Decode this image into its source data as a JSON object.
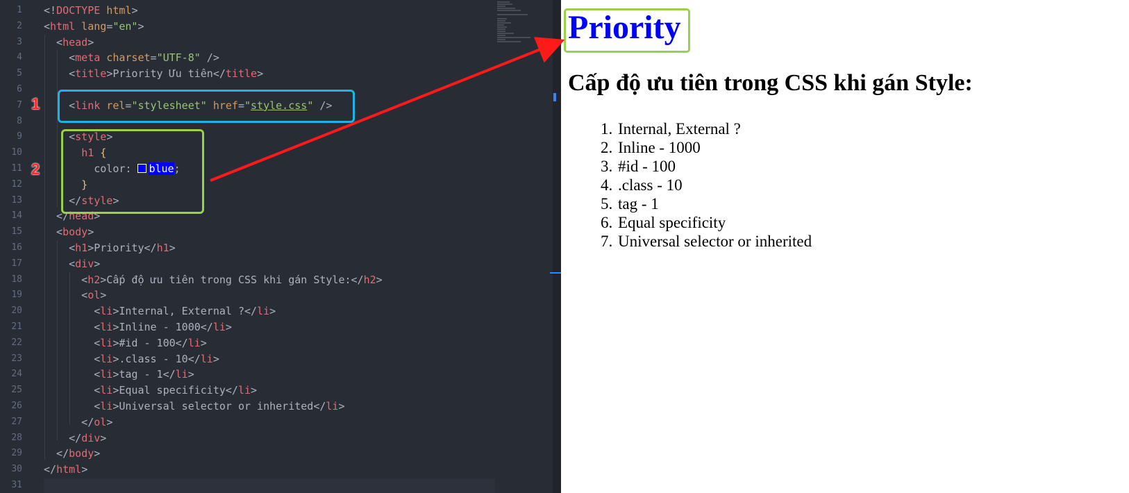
{
  "editor": {
    "line_numbers": [
      "1",
      "2",
      "3",
      "4",
      "5",
      "6",
      "7",
      "8",
      "9",
      "10",
      "11",
      "12",
      "13",
      "14",
      "15",
      "16",
      "17",
      "18",
      "19",
      "20",
      "21",
      "22",
      "23",
      "24",
      "25",
      "26",
      "27",
      "28",
      "29",
      "30",
      "31"
    ],
    "lines": [
      {
        "tokens": [
          {
            "c": "p",
            "t": "<!"
          },
          {
            "c": "t",
            "t": "DOCTYPE"
          },
          {
            "c": "a",
            "t": " html"
          },
          {
            "c": "p",
            "t": ">"
          }
        ]
      },
      {
        "tokens": [
          {
            "c": "p",
            "t": "<"
          },
          {
            "c": "t",
            "t": "html"
          },
          {
            "c": "a",
            "t": " lang"
          },
          {
            "c": "p",
            "t": "="
          },
          {
            "c": "s",
            "t": "\"en\""
          },
          {
            "c": "p",
            "t": ">"
          }
        ]
      },
      {
        "tokens": [
          {
            "c": "p",
            "t": "  <"
          },
          {
            "c": "t",
            "t": "head"
          },
          {
            "c": "p",
            "t": ">"
          }
        ]
      },
      {
        "tokens": [
          {
            "c": "p",
            "t": "    <"
          },
          {
            "c": "t",
            "t": "meta"
          },
          {
            "c": "a",
            "t": " charset"
          },
          {
            "c": "p",
            "t": "="
          },
          {
            "c": "s",
            "t": "\"UTF-8\""
          },
          {
            "c": "p",
            "t": " />"
          }
        ]
      },
      {
        "tokens": [
          {
            "c": "p",
            "t": "    <"
          },
          {
            "c": "t",
            "t": "title"
          },
          {
            "c": "p",
            "t": ">Priority Ưu tiên</"
          },
          {
            "c": "t",
            "t": "title"
          },
          {
            "c": "p",
            "t": ">"
          }
        ]
      },
      {
        "tokens": []
      },
      {
        "tokens": [
          {
            "c": "p",
            "t": "    <"
          },
          {
            "c": "t",
            "t": "link"
          },
          {
            "c": "a",
            "t": " rel"
          },
          {
            "c": "p",
            "t": "="
          },
          {
            "c": "s",
            "t": "\"stylesheet\""
          },
          {
            "c": "a",
            "t": " href"
          },
          {
            "c": "p",
            "t": "="
          },
          {
            "c": "s",
            "t": "\""
          },
          {
            "c": "u",
            "t": "style.css"
          },
          {
            "c": "s",
            "t": "\""
          },
          {
            "c": "p",
            "t": " />"
          }
        ]
      },
      {
        "tokens": []
      },
      {
        "tokens": [
          {
            "c": "p",
            "t": "    <"
          },
          {
            "c": "t",
            "t": "style"
          },
          {
            "c": "p",
            "t": ">"
          }
        ]
      },
      {
        "tokens": [
          {
            "c": "p",
            "t": "      "
          },
          {
            "c": "t",
            "t": "h1"
          },
          {
            "c": "y",
            "t": " {"
          }
        ]
      },
      {
        "tokens": [
          {
            "c": "p",
            "t": "        color: "
          },
          {
            "c": "sw",
            "t": ""
          },
          {
            "c": "bl",
            "t": "blue"
          },
          {
            "c": "p",
            "t": ";"
          }
        ]
      },
      {
        "tokens": [
          {
            "c": "y",
            "t": "      }"
          }
        ]
      },
      {
        "tokens": [
          {
            "c": "p",
            "t": "    </"
          },
          {
            "c": "t",
            "t": "style"
          },
          {
            "c": "p",
            "t": ">"
          }
        ]
      },
      {
        "tokens": [
          {
            "c": "p",
            "t": "  </"
          },
          {
            "c": "t",
            "t": "head"
          },
          {
            "c": "p",
            "t": ">"
          }
        ]
      },
      {
        "tokens": [
          {
            "c": "p",
            "t": "  <"
          },
          {
            "c": "t",
            "t": "body"
          },
          {
            "c": "p",
            "t": ">"
          }
        ]
      },
      {
        "tokens": [
          {
            "c": "p",
            "t": "    <"
          },
          {
            "c": "t",
            "t": "h1"
          },
          {
            "c": "p",
            "t": ">Priority</"
          },
          {
            "c": "t",
            "t": "h1"
          },
          {
            "c": "p",
            "t": ">"
          }
        ]
      },
      {
        "tokens": [
          {
            "c": "p",
            "t": "    <"
          },
          {
            "c": "t",
            "t": "div"
          },
          {
            "c": "p",
            "t": ">"
          }
        ]
      },
      {
        "tokens": [
          {
            "c": "p",
            "t": "      <"
          },
          {
            "c": "t",
            "t": "h2"
          },
          {
            "c": "p",
            "t": ">Cấp độ ưu tiên trong CSS khi gán Style:</"
          },
          {
            "c": "t",
            "t": "h2"
          },
          {
            "c": "p",
            "t": ">"
          }
        ]
      },
      {
        "tokens": [
          {
            "c": "p",
            "t": "      <"
          },
          {
            "c": "t",
            "t": "ol"
          },
          {
            "c": "p",
            "t": ">"
          }
        ]
      },
      {
        "tokens": [
          {
            "c": "p",
            "t": "        <"
          },
          {
            "c": "t",
            "t": "li"
          },
          {
            "c": "p",
            "t": ">Internal, External ?</"
          },
          {
            "c": "t",
            "t": "li"
          },
          {
            "c": "p",
            "t": ">"
          }
        ]
      },
      {
        "tokens": [
          {
            "c": "p",
            "t": "        <"
          },
          {
            "c": "t",
            "t": "li"
          },
          {
            "c": "p",
            "t": ">Inline - 1000</"
          },
          {
            "c": "t",
            "t": "li"
          },
          {
            "c": "p",
            "t": ">"
          }
        ]
      },
      {
        "tokens": [
          {
            "c": "p",
            "t": "        <"
          },
          {
            "c": "t",
            "t": "li"
          },
          {
            "c": "p",
            "t": ">#id - 100</"
          },
          {
            "c": "t",
            "t": "li"
          },
          {
            "c": "p",
            "t": ">"
          }
        ]
      },
      {
        "tokens": [
          {
            "c": "p",
            "t": "        <"
          },
          {
            "c": "t",
            "t": "li"
          },
          {
            "c": "p",
            "t": ">.class - 10</"
          },
          {
            "c": "t",
            "t": "li"
          },
          {
            "c": "p",
            "t": ">"
          }
        ]
      },
      {
        "tokens": [
          {
            "c": "p",
            "t": "        <"
          },
          {
            "c": "t",
            "t": "li"
          },
          {
            "c": "p",
            "t": ">tag - 1</"
          },
          {
            "c": "t",
            "t": "li"
          },
          {
            "c": "p",
            "t": ">"
          }
        ]
      },
      {
        "tokens": [
          {
            "c": "p",
            "t": "        <"
          },
          {
            "c": "t",
            "t": "li"
          },
          {
            "c": "p",
            "t": ">Equal specificity</"
          },
          {
            "c": "t",
            "t": "li"
          },
          {
            "c": "p",
            "t": ">"
          }
        ]
      },
      {
        "tokens": [
          {
            "c": "p",
            "t": "        <"
          },
          {
            "c": "t",
            "t": "li"
          },
          {
            "c": "p",
            "t": ">Universal selector or inherited</"
          },
          {
            "c": "t",
            "t": "li"
          },
          {
            "c": "p",
            "t": ">"
          }
        ]
      },
      {
        "tokens": [
          {
            "c": "p",
            "t": "      </"
          },
          {
            "c": "t",
            "t": "ol"
          },
          {
            "c": "p",
            "t": ">"
          }
        ]
      },
      {
        "tokens": [
          {
            "c": "p",
            "t": "    </"
          },
          {
            "c": "t",
            "t": "div"
          },
          {
            "c": "p",
            "t": ">"
          }
        ]
      },
      {
        "tokens": [
          {
            "c": "p",
            "t": "  </"
          },
          {
            "c": "t",
            "t": "body"
          },
          {
            "c": "p",
            "t": ">"
          }
        ]
      },
      {
        "tokens": [
          {
            "c": "p",
            "t": "</"
          },
          {
            "c": "t",
            "t": "html"
          },
          {
            "c": "p",
            "t": ">"
          }
        ]
      },
      {
        "tokens": []
      }
    ]
  },
  "annotations": {
    "label_1": "1",
    "label_2": "2",
    "colors": {
      "external_box": "#1fb2e6",
      "internal_box": "#9ad14b",
      "arrow": "#ff1a1a"
    }
  },
  "preview": {
    "h1": "Priority",
    "h2": "Cấp độ ưu tiên trong CSS khi gán Style:",
    "items": [
      "Internal, External ?",
      "Inline - 1000",
      "#id - 100",
      ".class - 10",
      "tag - 1",
      "Equal specificity",
      "Universal selector or inherited"
    ]
  }
}
